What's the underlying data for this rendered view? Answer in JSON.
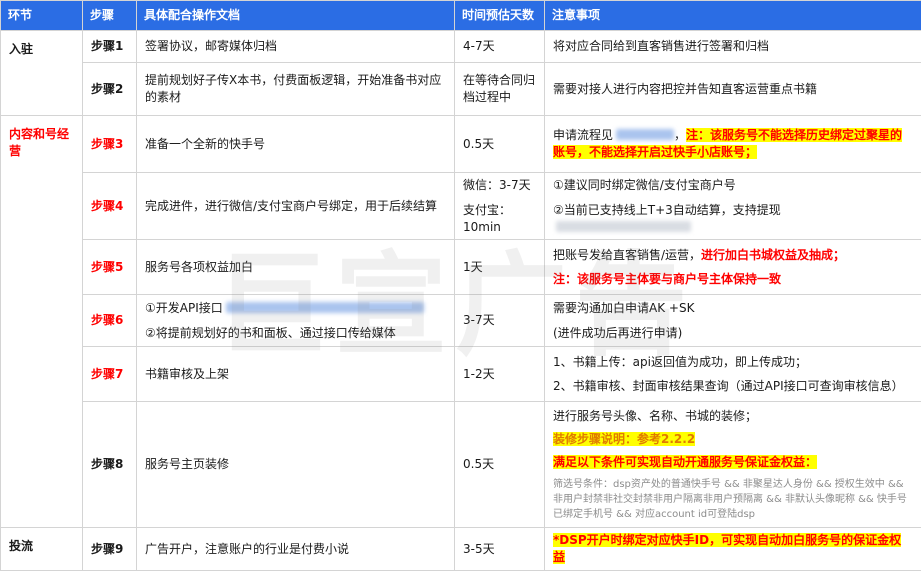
{
  "watermark": "巨宣广告",
  "colors": {
    "header_bg": "#2b6de4",
    "warning_red": "#ff0000",
    "highlight_yellow": "#ffff00",
    "orange": "#e07b00"
  },
  "header": {
    "phase": "环节",
    "step": "步骤",
    "doc": "具体配合操作文档",
    "time": "时间预估天数",
    "notes": "注意事项"
  },
  "rows": {
    "r1": {
      "phase": "入驻",
      "step": "步骤1",
      "doc": "签署协议，邮寄媒体归档",
      "time": "4-7天",
      "note": "将对应合同给到直客销售进行签署和归档"
    },
    "r2": {
      "step": "步骤2",
      "doc": "提前规划好子传X本书，付费面板逻辑，开始准备书对应的素材",
      "time": "在等待合同归档过程中",
      "note": "需要对接人进行内容把控并告知直客运营重点书籍"
    },
    "r3": {
      "phase": "内容和号经营",
      "step": "步骤3",
      "doc": "准备一个全新的快手号",
      "time": "0.5天",
      "note_prefix": "申请流程见",
      "note_sep": "，",
      "note_warn": "注：该服务号不能选择历史绑定过聚星的账号，不能选择开启过快手小店账号；"
    },
    "r4": {
      "step": "步骤4",
      "doc": "完成进件，进行微信/支付宝商户号绑定，用于后续结算",
      "time1": "微信：3-7天",
      "time2": "支付宝：10min",
      "note1": "①建议同时绑定微信/支付宝商户号",
      "note2": "②当前已支持线上T+3自动结算，支持提现"
    },
    "r5": {
      "step": "步骤5",
      "doc": "服务号各项权益加白",
      "time": "1天",
      "note1a": "把账号发给直客销售/运营，",
      "note1b": "进行加白书城权益及抽成；",
      "note2": "注：该服务号主体要与商户号主体保持一致"
    },
    "r6": {
      "step": "步骤6",
      "doc1": "①开发API接口",
      "doc2": "②将提前规划好的书和面板、通过接口传给媒体",
      "time": "3-7天",
      "note1": "需要沟通加白申请AK +SK",
      "note2": "(进件成功后再进行申请)"
    },
    "r7": {
      "step": "步骤7",
      "doc": "书籍审核及上架",
      "time": "1-2天",
      "note1": "1、书籍上传：api返回值为成功，即上传成功；",
      "note2": "2、书籍审核、封面审核结果查询（通过API接口可查询审核信息）"
    },
    "r8": {
      "step": "步骤8",
      "doc": "服务号主页装修",
      "time": "0.5天",
      "note1": "进行服务号头像、名称、书城的装修；",
      "note2": "装修步骤说明：参考2.2.2",
      "note3": "满足以下条件可实现自动开通服务号保证金权益：",
      "note4": "筛选号条件：dsp资产处的普通快手号 && 非聚星达人身份 && 授权生效中 && 非用户封禁非社交封禁非用户隔离非用户预隔离 && 非默认头像昵称 && 快手号已绑定手机号 && 对应account id可登陆dsp"
    },
    "r9": {
      "phase": "投流",
      "step": "步骤9",
      "doc": "广告开户，注意账户的行业是付费小说",
      "time": "3-5天",
      "note": "*DSP开户时绑定对应快手ID，可实现自动加白服务号的保证金权益"
    }
  }
}
